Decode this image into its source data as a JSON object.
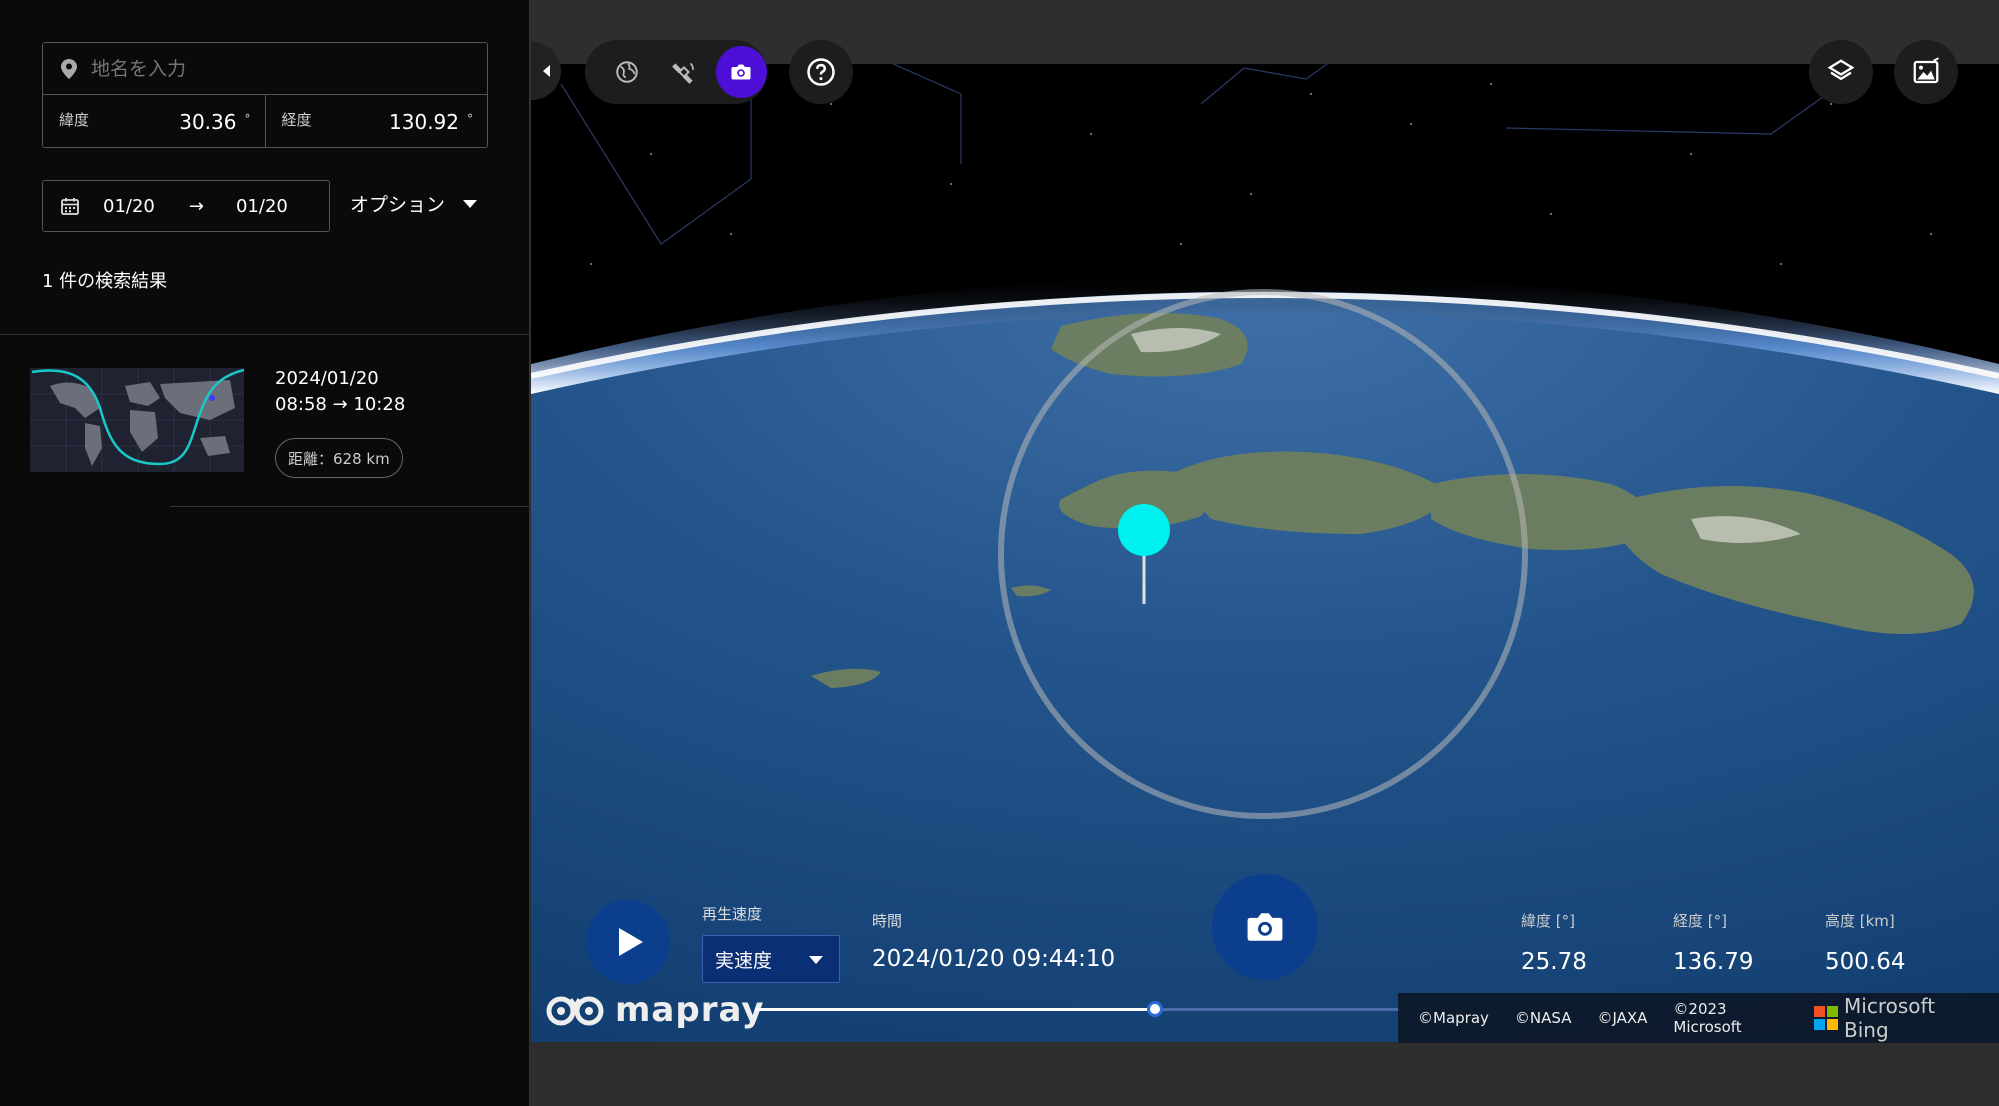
{
  "sidebar": {
    "search_placeholder": "地名を入力",
    "lat_label": "緯度",
    "lat_value": "30.36",
    "lon_label": "経度",
    "lon_value": "130.92",
    "degree_unit": "°",
    "date_from": "01/20",
    "date_arrow": "→",
    "date_to": "01/20",
    "option_label": "オプション",
    "result_count": "1 件の検索結果",
    "results": [
      {
        "date": "2024/01/20",
        "time": "08:58 → 10:28",
        "distance": "距離：628 km"
      }
    ]
  },
  "toolbar": {
    "tools": [
      {
        "icon": "globe-icon",
        "active": false
      },
      {
        "icon": "satellite-icon",
        "active": false
      },
      {
        "icon": "camera-icon",
        "active": true
      }
    ],
    "help_icon": "help-icon",
    "layers_icon": "layers-icon",
    "image-icon": "image-icon"
  },
  "playback": {
    "speed_label": "再生速度",
    "speed_value": "実速度",
    "time_label": "時間",
    "time_value": "2024/01/20 09:44:10",
    "progress": 0.62
  },
  "stats": [
    {
      "label": "緯度 [°]",
      "value": "25.78"
    },
    {
      "label": "経度 [°]",
      "value": "136.79"
    },
    {
      "label": "高度 [km]",
      "value": "500.64"
    }
  ],
  "branding": {
    "logo_text": "mapray"
  },
  "credits": {
    "items": [
      "©Mapray",
      "©NASA",
      "©JAXA",
      "©2023 Microsoft"
    ],
    "bing": "Microsoft Bing"
  },
  "colors": {
    "accent": "#4d0fd6",
    "button_blue": "#0b3f8d",
    "marker": "#00f0f0"
  }
}
